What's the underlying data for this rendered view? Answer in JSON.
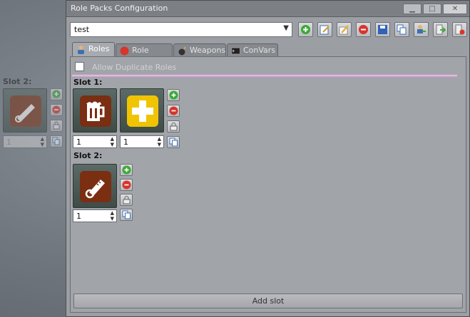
{
  "ghost": {
    "slot_label": "Slot 2:",
    "count_value": "1"
  },
  "window": {
    "title": "Role Packs Configuration",
    "minimize": "▁",
    "maximize": "□",
    "close": "✕"
  },
  "toolbar": {
    "pack_name": "test",
    "buttons": [
      "add-pack",
      "rename-pack",
      "edit-pack",
      "delete-pack",
      "save-pack",
      "copy-pack",
      "import-users",
      "import-pack",
      "export-pack"
    ]
  },
  "tabs": [
    {
      "label": "Roles",
      "icon": "user-icon",
      "active": true
    },
    {
      "label": "Role Blocks",
      "icon": "red-circle-icon",
      "active": false
    },
    {
      "label": "Weapons",
      "icon": "bomb-icon",
      "active": false
    },
    {
      "label": "ConVars",
      "icon": "console-icon",
      "active": false
    }
  ],
  "roles_tab": {
    "allow_duplicate_label": "Allow Duplicate Roles",
    "allow_duplicate_checked": false,
    "slots": [
      {
        "label": "Slot 1:",
        "roles": [
          {
            "icon": "beer-mug-icon",
            "color": "#7a2e12",
            "count": "1"
          },
          {
            "icon": "medic-cross-icon",
            "color": "#f0c400",
            "count": "1"
          }
        ]
      },
      {
        "label": "Slot 2:",
        "roles": [
          {
            "icon": "chainsaw-icon",
            "color": "#7a2e12",
            "count": "1"
          }
        ]
      }
    ],
    "add_slot_label": "Add slot"
  },
  "colors": {
    "window_bg": "#9b9ea3",
    "accent_line": "#d9a3d8",
    "brown_role": "#7a2e12",
    "yellow_role": "#f0c400",
    "add_green": "#3aa935",
    "remove_red": "#d8352b"
  }
}
